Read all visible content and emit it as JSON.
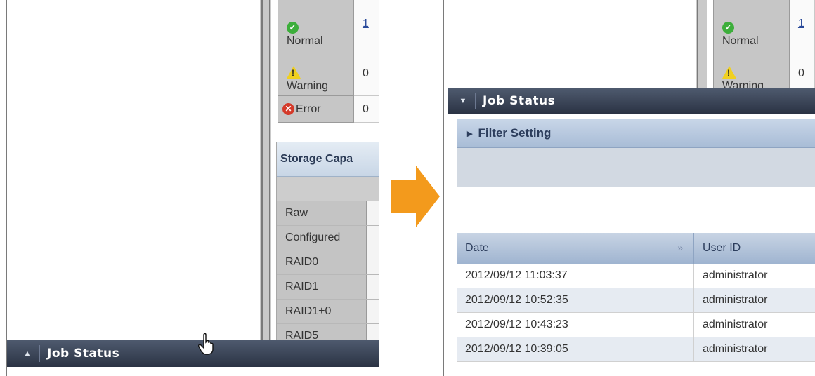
{
  "left": {
    "status": [
      {
        "label": "Normal",
        "value": "1",
        "icon": "check-icon"
      },
      {
        "label": "Warning",
        "value": "0",
        "icon": "warning-icon"
      },
      {
        "label": "Error",
        "value": "0",
        "icon": "error-icon"
      }
    ],
    "storage_capacity": {
      "title": "Storage Capa",
      "rows": [
        "Raw",
        "Configured",
        "RAID0",
        "RAID1",
        "RAID1+0",
        "RAID5"
      ]
    },
    "job_status_bar": {
      "title": "Job Status",
      "toggle": "▲"
    }
  },
  "right": {
    "status": [
      {
        "label": "Normal",
        "value": "1",
        "icon": "check-icon"
      },
      {
        "label": "Warning",
        "value": "0",
        "icon": "warning-icon"
      }
    ],
    "job_status_panel": {
      "title": "Job Status",
      "toggle": "▼",
      "filter_label": "Filter Setting",
      "columns": [
        "Date",
        "User ID"
      ],
      "rows": [
        {
          "date": "2012/09/12 11:03:37",
          "user": "administrator"
        },
        {
          "date": "2012/09/12 10:52:35",
          "user": "administrator"
        },
        {
          "date": "2012/09/12 10:43:23",
          "user": "administrator"
        },
        {
          "date": "2012/09/12 10:39:05",
          "user": "administrator"
        }
      ]
    }
  },
  "colors": {
    "arrow": "#f39a1c",
    "bar": "#2f3849",
    "header_blue": "#b4c6dc"
  }
}
